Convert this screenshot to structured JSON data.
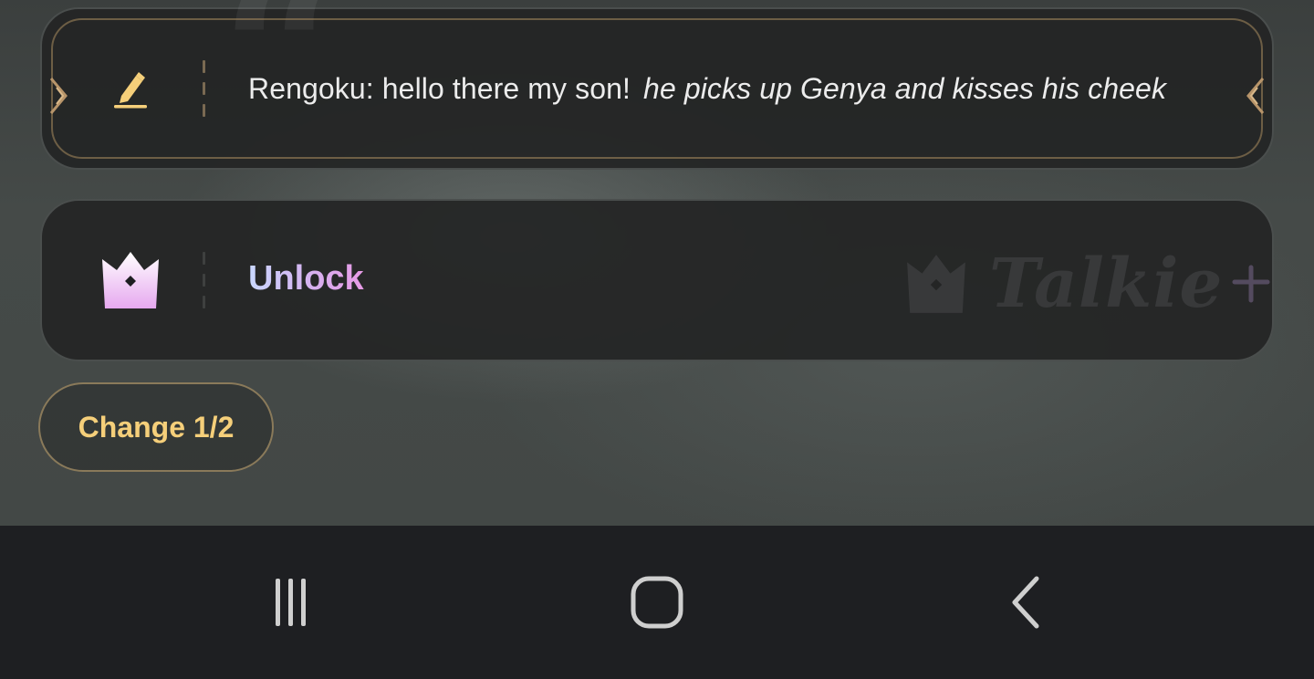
{
  "message_card": {
    "speaker_text": "Rengoku: hello there my son!",
    "action_text": "he picks up Genya and kisses his cheek",
    "icon": "pencil-edit-icon"
  },
  "unlock_card": {
    "label": "Unlock",
    "icon": "crown-icon",
    "watermark_text": "Talkie"
  },
  "change_button": {
    "label": "Change 1/2"
  },
  "nav_bar": {
    "recents_icon": "recents-icon",
    "home_icon": "home-icon",
    "back_icon": "back-icon"
  },
  "colors": {
    "accent_gold": "#f5cf7a",
    "card_bg": "#242525",
    "nav_bg": "#1e1f22"
  }
}
